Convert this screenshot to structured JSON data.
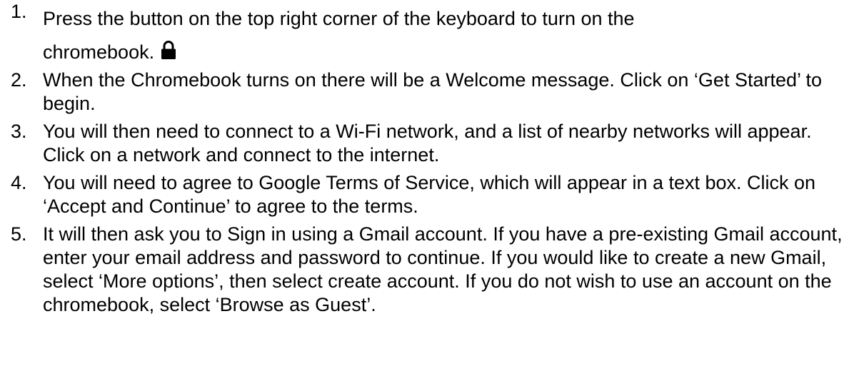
{
  "steps": [
    {
      "number": "1.",
      "text_line1": "Press the button on the top right corner of the keyboard to turn on the",
      "text_line2": "chromebook.",
      "icon": "lock-icon"
    },
    {
      "number": "2.",
      "text": "When the Chromebook turns on there will be a Welcome message. Click on ‘Get Started’ to begin."
    },
    {
      "number": "3.",
      "text": "You will then need to connect to a Wi-Fi network, and a list of nearby networks will appear. Click on a network and connect to the internet."
    },
    {
      "number": "4.",
      "text": "You will need to agree to Google Terms of Service, which will appear in a text box. Click on ‘Accept and Continue’ to agree to the terms."
    },
    {
      "number": "5.",
      "text": "It will then ask you to Sign in using a Gmail account. If you have a pre-existing Gmail account, enter your email address and password to continue. If you would like to create a new Gmail, select ‘More options’, then select create account. If you do not wish to use an account on the chromebook, select ‘Browse as Guest’."
    }
  ]
}
